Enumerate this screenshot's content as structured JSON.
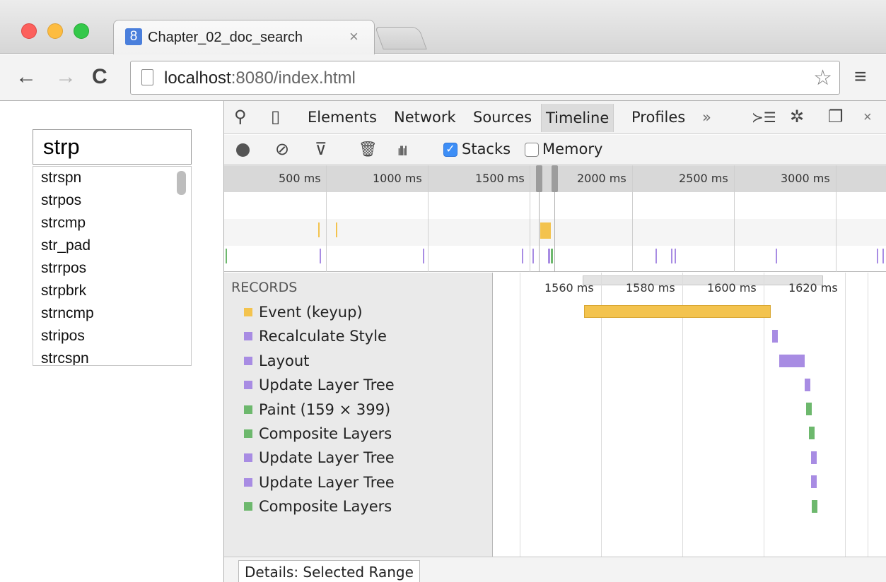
{
  "browser": {
    "tab_title": "Chapter_02_doc_search",
    "tab_close": "×",
    "favicon_letter": "8",
    "url_host": "localhost",
    "url_rest": ":8080/index.html",
    "back": "←",
    "forward": "→",
    "reload": "C",
    "star": "☆",
    "menu": "≡"
  },
  "page": {
    "search_value": "strp",
    "results": [
      "strspn",
      "strpos",
      "strcmp",
      "str_pad",
      "strrpos",
      "strpbrk",
      "strncmp",
      "stripos",
      "strcspn"
    ]
  },
  "devtools": {
    "tabs": [
      "Elements",
      "Network",
      "Sources",
      "Timeline",
      "Profiles"
    ],
    "active_tab": "Timeline",
    "more": "»",
    "search_icon": "⚲",
    "device_icon": "▯",
    "console_icon": "≻☰",
    "settings_icon": "✲",
    "dock_icon": "❐",
    "close_icon": "×",
    "controls": {
      "clear_icon": "⊘",
      "filter_icon": "⊽",
      "trash_icon": "🗑",
      "bars_icon": "ıllıl",
      "stacks_label": "Stacks",
      "stacks_checked": true,
      "memory_label": "Memory",
      "memory_checked": false
    },
    "overview_ticks": [
      "500 ms",
      "1000 ms",
      "1500 ms",
      "2000 ms",
      "2500 ms",
      "3000 ms"
    ],
    "records_header": "RECORDS",
    "records": [
      {
        "label": "Event (keyup)",
        "color": "#f3c34e"
      },
      {
        "label": "Recalculate Style",
        "color": "#a88ce3"
      },
      {
        "label": "Layout",
        "color": "#a88ce3"
      },
      {
        "label": "Update Layer Tree",
        "color": "#a88ce3"
      },
      {
        "label": "Paint (159 × 399)",
        "color": "#6db86d"
      },
      {
        "label": "Composite Layers",
        "color": "#6db86d"
      },
      {
        "label": "Update Layer Tree",
        "color": "#a88ce3"
      },
      {
        "label": "Update Layer Tree",
        "color": "#a88ce3"
      },
      {
        "label": "Composite Layers",
        "color": "#6db86d"
      }
    ],
    "flame_ticks": [
      "1560 ms",
      "1580 ms",
      "1600 ms",
      "1620 ms"
    ],
    "details_tab": "Details: Selected Range"
  },
  "colors": {
    "scripting": "#f3c34e",
    "rendering": "#a88ce3",
    "painting": "#6db86d",
    "checkbox_blue": "#3d8ef6"
  }
}
